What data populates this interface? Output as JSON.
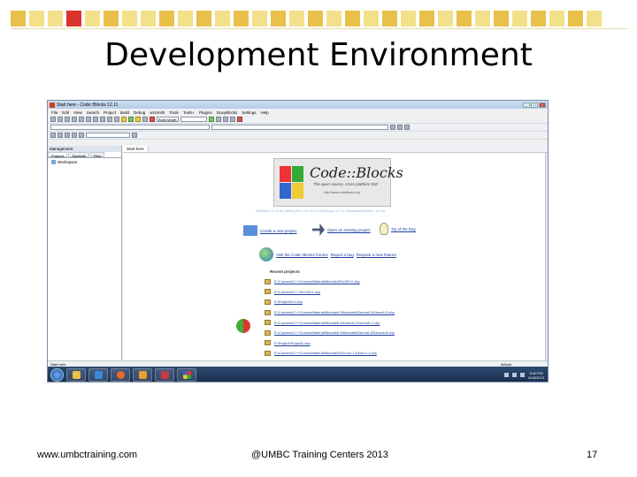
{
  "slide": {
    "title": "Development Environment",
    "footer_left": "www.umbctraining.com",
    "footer_center": "@UMBC Training Centers 2013",
    "page_number": "17"
  },
  "window": {
    "title": "Start here - Code::Blocks 12.11",
    "menu": [
      "File",
      "Edit",
      "View",
      "Search",
      "Project",
      "Build",
      "Debug",
      "wxSmith",
      "Tools",
      "Tools+",
      "Plugins",
      "DoxyBlocks",
      "Settings",
      "Help"
    ],
    "build_target": "Build target:"
  },
  "management": {
    "header": "Management",
    "tabs": [
      "Projects",
      "Symbols",
      "Files"
    ],
    "workspace": "Workspace"
  },
  "editor": {
    "tab": "Start here",
    "logo_text": "Code::Blocks",
    "logo_tagline": "The open source, cross platform IDE",
    "logo_url": "http://www.codeblocks.org",
    "release_info": "Release 12.11 rev 8629 (2012-11-25 12:48:20) gcc 4.7.1 Windows/unicode - 32 bit",
    "actions": {
      "create": "Create a new project",
      "open": "Open an existing project",
      "tips": "Tip of the Day",
      "forums": "Visit the Code::Blocks forums",
      "bug": "Report a bug",
      "feature": "Request a new feature"
    },
    "recent_header": "Recent projects",
    "recent_projects": [
      "E:\\Courses\\C++\\CourseMaterial\\Module4\\Ex1\\Ex1.cbp",
      "E:\\Courses\\C++\\Ex1\\Ex1.cbp",
      "E:\\Project\\6-4.cbp",
      "E:\\Courses\\C++\\CourseMaterial\\Module6-5\\Module6\\Demo6-5\\Demo6-5.cbp",
      "E:\\Courses\\C++\\CourseMaterial\\Module6-5\\Demo6-2\\Demo6-2.cbp",
      "E:\\Courses\\C++\\CourseMaterial\\Module6-5\\Module6\\Demo6-5\\Demo6-5.cbp",
      "E:\\Project\\Project1.cbp",
      "E:\\Courses\\C++\\CourseMaterial\\Module2\\Demo2-1\\Demo2-1.cbp"
    ]
  },
  "status": {
    "left": "Start here",
    "right": "default"
  },
  "taskbar": {
    "time": "3:40 PM",
    "date": "6/18/2013"
  }
}
